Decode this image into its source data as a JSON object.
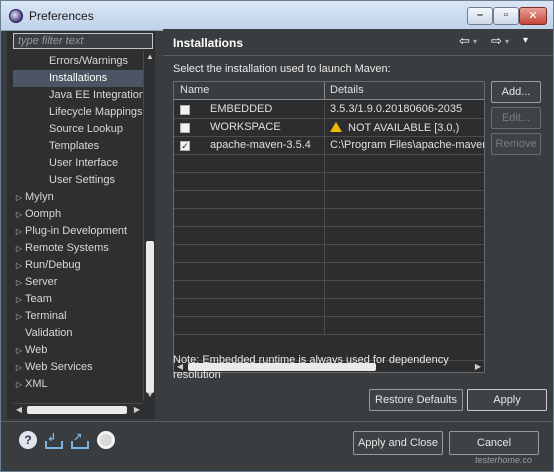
{
  "window": {
    "title": "Preferences"
  },
  "filter": {
    "placeholder": "type filter text"
  },
  "tree": {
    "items": [
      {
        "label": "Errors/Warnings",
        "indent": 2,
        "arrow": ""
      },
      {
        "label": "Installations",
        "indent": 2,
        "arrow": "",
        "selected": true
      },
      {
        "label": "Java EE Integration",
        "indent": 2,
        "arrow": ""
      },
      {
        "label": "Lifecycle Mappings",
        "indent": 2,
        "arrow": ""
      },
      {
        "label": "Source Lookup",
        "indent": 2,
        "arrow": ""
      },
      {
        "label": "Templates",
        "indent": 2,
        "arrow": ""
      },
      {
        "label": "User Interface",
        "indent": 2,
        "arrow": ""
      },
      {
        "label": "User Settings",
        "indent": 2,
        "arrow": ""
      },
      {
        "label": "Mylyn",
        "indent": 0,
        "arrow": "▷"
      },
      {
        "label": "Oomph",
        "indent": 0,
        "arrow": "▷"
      },
      {
        "label": "Plug-in Development",
        "indent": 0,
        "arrow": "▷"
      },
      {
        "label": "Remote Systems",
        "indent": 0,
        "arrow": "▷"
      },
      {
        "label": "Run/Debug",
        "indent": 0,
        "arrow": "▷"
      },
      {
        "label": "Server",
        "indent": 0,
        "arrow": "▷"
      },
      {
        "label": "Team",
        "indent": 0,
        "arrow": "▷"
      },
      {
        "label": "Terminal",
        "indent": 0,
        "arrow": "▷"
      },
      {
        "label": "Validation",
        "indent": 0,
        "arrow": ""
      },
      {
        "label": "Web",
        "indent": 0,
        "arrow": "▷"
      },
      {
        "label": "Web Services",
        "indent": 0,
        "arrow": "▷"
      },
      {
        "label": "XML",
        "indent": 0,
        "arrow": "▷"
      }
    ]
  },
  "main": {
    "title": "Installations",
    "nav": {
      "back": "⇦",
      "forward": "⇨",
      "menu": "▾"
    },
    "prompt": "Select the installation used to launch Maven:",
    "table": {
      "columns": [
        "Name",
        "Details"
      ],
      "rows": [
        {
          "checked": false,
          "name": "EMBEDDED",
          "details": "3.5.3/1.9.0.20180606-2035",
          "warning": false
        },
        {
          "checked": false,
          "name": "WORKSPACE",
          "details": "NOT AVAILABLE [3.0,)",
          "warning": true
        },
        {
          "checked": true,
          "name": "apache-maven-3.5.4",
          "details": "C:\\Program Files\\apache-maven",
          "warning": false
        }
      ],
      "empty_rows": 10
    },
    "buttons": {
      "add": "Add...",
      "edit": "Edit...",
      "remove": "Remove"
    },
    "note": "Note: Embedded runtime is always used for dependency resolution",
    "restore_defaults": "Restore Defaults",
    "apply": "Apply"
  },
  "footer": {
    "apply_and_close": "Apply and Close",
    "cancel": "Cancel",
    "watermark": "testerhome.co"
  }
}
